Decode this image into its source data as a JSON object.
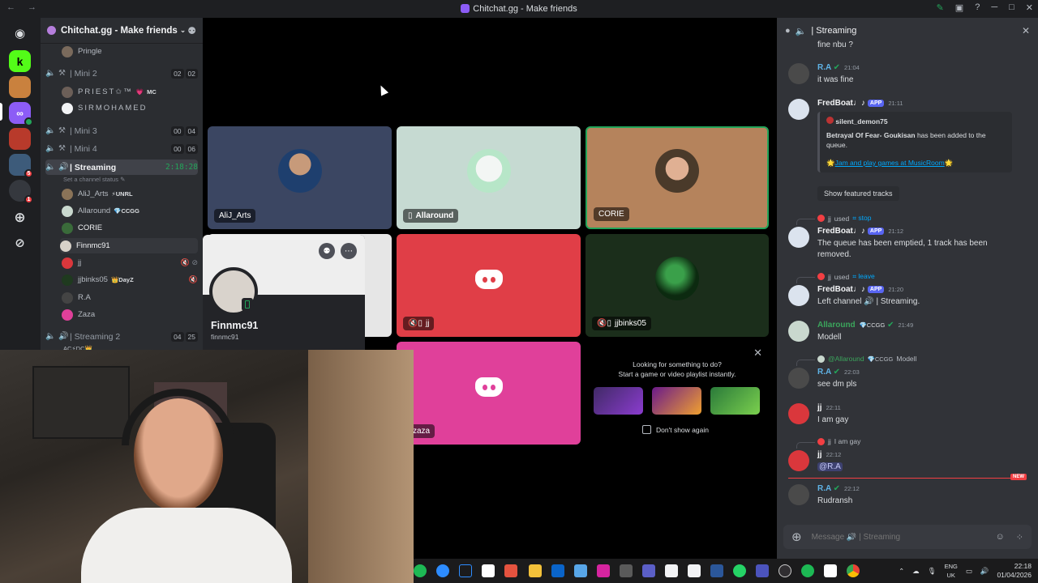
{
  "window": {
    "title": "Chitchat.gg - Make friends",
    "nav": "← →"
  },
  "server": {
    "name": "Chitchat.gg - Make friends"
  },
  "channels": [
    {
      "id": "pringle",
      "kind": "user",
      "label": "Pringle"
    },
    {
      "id": "mini2",
      "label": "| Mini 2",
      "counts": [
        "02",
        "02"
      ]
    },
    {
      "id": "mini3",
      "label": "| Mini 3",
      "counts": [
        "00",
        "04"
      ]
    },
    {
      "id": "mini4",
      "label": "| Mini 4",
      "counts": [
        "00",
        "06"
      ]
    },
    {
      "id": "streaming",
      "label": "| Streaming",
      "timer": "2:18:28",
      "status": "Set a channel status"
    },
    {
      "id": "streaming2",
      "label": "| Streaming 2",
      "counts": [
        "04",
        "25"
      ],
      "sub": "AC⚡DC👑"
    }
  ],
  "mini2_users": [
    {
      "name": "PRIEST✩™",
      "tag": "MC"
    },
    {
      "name": "SIRMOHAMED",
      "tag": ""
    }
  ],
  "streaming_users": [
    {
      "name": "AliJ_Arts",
      "tag": "⚡UNRL",
      "color": "#8a7358"
    },
    {
      "name": "Allaround",
      "tag": "💎CCGG",
      "color": "#c9d8ce"
    },
    {
      "name": "CORIE",
      "tag": "",
      "color": "#3a6b3a"
    },
    {
      "name": "Finnmc91",
      "tag": "",
      "color": "#d8d2c9"
    },
    {
      "name": "jj",
      "tag": "",
      "color": "#da373c"
    },
    {
      "name": "jjbinks05",
      "tag": "👑DayZ",
      "color": "#1f3a1f"
    },
    {
      "name": "R.A",
      "tag": "",
      "color": "#444"
    },
    {
      "name": "Zaza",
      "tag": "",
      "color": "#e0409a"
    }
  ],
  "tiles": {
    "alij": "AliJ_Arts",
    "allaround": "Allaround",
    "corie": "CORIE",
    "jj": "jj",
    "jjbinks": "jjbinks05",
    "zaza": "zaza"
  },
  "profile": {
    "name": "Finnmc91",
    "username": "finnmc91"
  },
  "activity": {
    "line1": "Looking for something to do?",
    "line2": "Start a game or video playlist instantly.",
    "dont_show": "Don't show again"
  },
  "chat": {
    "channel": "| Streaming",
    "top_fragment": "fine nbu ?",
    "placeholder": "Message 🔊 | Streaming",
    "app_label": "APP",
    "new_label": "NEW",
    "messages": [
      {
        "author": "R.A",
        "time": "21:04",
        "text": "it was fine"
      },
      {
        "author": "FredBoat♩♪",
        "time": "21:11",
        "embed_author": "silent_demon75",
        "embed_song": "Betrayal Of Fear- Goukisan",
        "embed_rest": " has been added to the queue.",
        "embed_link_pre": "🌟",
        "embed_link1": "Jam and play games at ",
        "embed_link2": "MusicRoom",
        "embed_link_post": "🌟",
        "button": "Show featured tracks"
      },
      {
        "reply_user": "jj",
        "reply_used": "used",
        "reply_cmd": "⌗ stop",
        "author": "FredBoat♩♪",
        "time": "21:12",
        "text": "The queue has been emptied, 1 track has been removed."
      },
      {
        "reply_user": "jj",
        "reply_used": "used",
        "reply_cmd": "⌗ leave",
        "author": "FredBoat♩♪",
        "time": "21:20",
        "text": "Left channel 🔊 | Streaming."
      },
      {
        "author": "Allaround",
        "tag": "💎CCGG",
        "time": "21:49",
        "text": "Modell"
      },
      {
        "reply_user": "@Allaround",
        "reply_tag": "💎CCGG",
        "reply_text": "Modell",
        "author": "R.A",
        "time": "22:03",
        "text": "see dm pls"
      },
      {
        "author": "jj",
        "time": "22:11",
        "text": "I am gay"
      },
      {
        "reply_user": "jj",
        "reply_text": "I am gay",
        "author": "jj",
        "time": "22:12",
        "text": "@R.A"
      },
      {
        "author": "R.A",
        "time": "22:12",
        "text": "Rudransh"
      }
    ]
  },
  "taskbar": {
    "lang": "ENG",
    "region": "UK",
    "time": "22:18",
    "date": "01/04/2026"
  },
  "colors": {
    "accent": "#5865f2",
    "voice_green": "#23a55a",
    "danger": "#f23f43"
  }
}
